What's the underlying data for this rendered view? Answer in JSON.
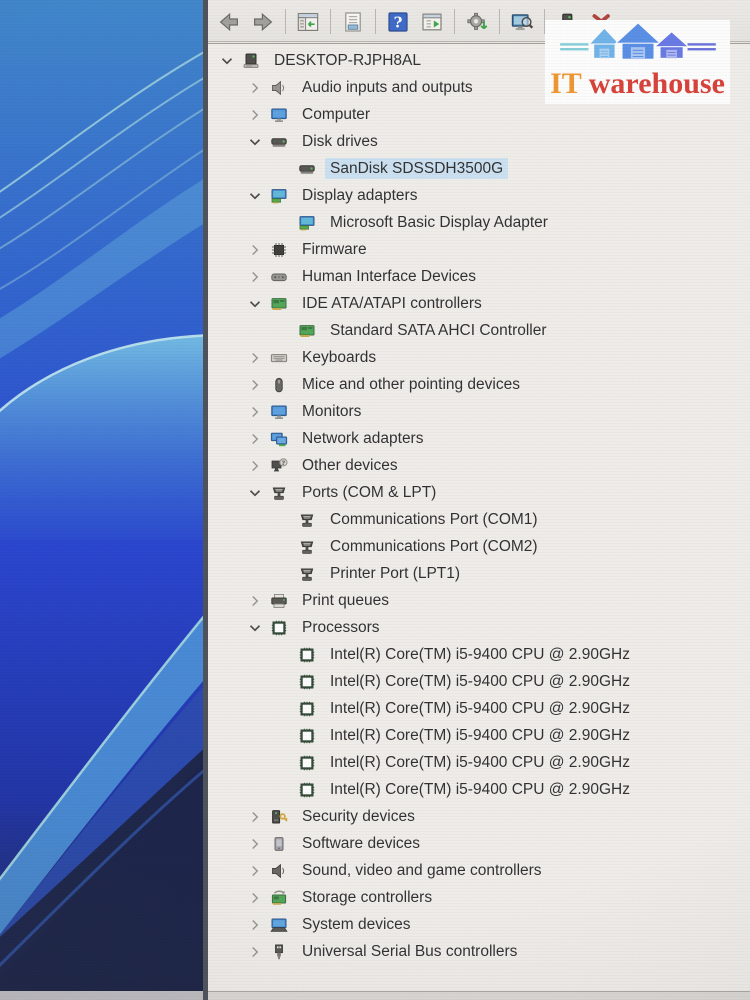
{
  "logo": {
    "it": "IT",
    "warehouse": "warehouse",
    "icon": "three-houses-logo"
  },
  "toolbar": {
    "buttons": [
      {
        "icon": "back-arrow",
        "name": "back-button"
      },
      {
        "icon": "forward-arrow",
        "name": "forward-button"
      },
      {
        "sep": true
      },
      {
        "icon": "console-tree",
        "name": "show-hide-console-tree-button"
      },
      {
        "sep": true
      },
      {
        "icon": "properties",
        "name": "properties-button"
      },
      {
        "sep": true
      },
      {
        "icon": "help",
        "name": "help-button"
      },
      {
        "icon": "update-driver",
        "name": "update-driver-button"
      },
      {
        "sep": true
      },
      {
        "icon": "gear-update",
        "name": "driver-settings-button"
      },
      {
        "sep": true
      },
      {
        "icon": "scan-computer",
        "name": "scan-hardware-changes-button"
      },
      {
        "sep": true
      },
      {
        "icon": "device-dark",
        "name": "device-action-button"
      },
      {
        "icon": "uninstall-x",
        "name": "uninstall-device-button"
      }
    ],
    "colors": {
      "uninstall_red": "#a9362c",
      "action_green": "#2f9e38",
      "help_blue": "#2d5ec6"
    }
  },
  "tree": {
    "selection_color": "#c9e0f2",
    "items": [
      {
        "label": "DESKTOP-RJPH8AL",
        "level": 0,
        "state": "expanded",
        "icon": "computer-root",
        "selected": false
      },
      {
        "label": "Audio inputs and outputs",
        "level": 1,
        "state": "collapsed",
        "icon": "speaker",
        "selected": false
      },
      {
        "label": "Computer",
        "level": 1,
        "state": "collapsed",
        "icon": "monitor",
        "selected": false
      },
      {
        "label": "Disk drives",
        "level": 1,
        "state": "expanded",
        "icon": "disk",
        "selected": false
      },
      {
        "label": "SanDisk SDSSDH3500G",
        "level": 2,
        "state": "leaf",
        "icon": "disk",
        "selected": true
      },
      {
        "label": "Display adapters",
        "level": 1,
        "state": "expanded",
        "icon": "display-adapter",
        "selected": false
      },
      {
        "label": "Microsoft Basic Display Adapter",
        "level": 2,
        "state": "leaf",
        "icon": "display-adapter",
        "selected": false
      },
      {
        "label": "Firmware",
        "level": 1,
        "state": "collapsed",
        "icon": "chip",
        "selected": false
      },
      {
        "label": "Human Interface Devices",
        "level": 1,
        "state": "collapsed",
        "icon": "hid",
        "selected": false
      },
      {
        "label": "IDE ATA/ATAPI controllers",
        "level": 1,
        "state": "expanded",
        "icon": "ide-card",
        "selected": false
      },
      {
        "label": "Standard SATA AHCI Controller",
        "level": 2,
        "state": "leaf",
        "icon": "ide-card",
        "selected": false
      },
      {
        "label": "Keyboards",
        "level": 1,
        "state": "collapsed",
        "icon": "keyboard",
        "selected": false
      },
      {
        "label": "Mice and other pointing devices",
        "level": 1,
        "state": "collapsed",
        "icon": "mouse",
        "selected": false
      },
      {
        "label": "Monitors",
        "level": 1,
        "state": "collapsed",
        "icon": "monitor",
        "selected": false
      },
      {
        "label": "Network adapters",
        "level": 1,
        "state": "collapsed",
        "icon": "network",
        "selected": false
      },
      {
        "label": "Other devices",
        "level": 1,
        "state": "collapsed",
        "icon": "unknown-device",
        "selected": false
      },
      {
        "label": "Ports (COM & LPT)",
        "level": 1,
        "state": "expanded",
        "icon": "port",
        "selected": false
      },
      {
        "label": "Communications Port (COM1)",
        "level": 2,
        "state": "leaf",
        "icon": "port",
        "selected": false
      },
      {
        "label": "Communications Port (COM2)",
        "level": 2,
        "state": "leaf",
        "icon": "port",
        "selected": false
      },
      {
        "label": "Printer Port (LPT1)",
        "level": 2,
        "state": "leaf",
        "icon": "port",
        "selected": false
      },
      {
        "label": "Print queues",
        "level": 1,
        "state": "collapsed",
        "icon": "printer",
        "selected": false
      },
      {
        "label": "Processors",
        "level": 1,
        "state": "expanded",
        "icon": "cpu",
        "selected": false
      },
      {
        "label": "Intel(R) Core(TM) i5-9400 CPU @ 2.90GHz",
        "level": 2,
        "state": "leaf",
        "icon": "cpu",
        "selected": false
      },
      {
        "label": "Intel(R) Core(TM) i5-9400 CPU @ 2.90GHz",
        "level": 2,
        "state": "leaf",
        "icon": "cpu",
        "selected": false
      },
      {
        "label": "Intel(R) Core(TM) i5-9400 CPU @ 2.90GHz",
        "level": 2,
        "state": "leaf",
        "icon": "cpu",
        "selected": false
      },
      {
        "label": "Intel(R) Core(TM) i5-9400 CPU @ 2.90GHz",
        "level": 2,
        "state": "leaf",
        "icon": "cpu",
        "selected": false
      },
      {
        "label": "Intel(R) Core(TM) i5-9400 CPU @ 2.90GHz",
        "level": 2,
        "state": "leaf",
        "icon": "cpu",
        "selected": false
      },
      {
        "label": "Intel(R) Core(TM) i5-9400 CPU @ 2.90GHz",
        "level": 2,
        "state": "leaf",
        "icon": "cpu",
        "selected": false
      },
      {
        "label": "Security devices",
        "level": 1,
        "state": "collapsed",
        "icon": "security",
        "selected": false
      },
      {
        "label": "Software devices",
        "level": 1,
        "state": "collapsed",
        "icon": "software",
        "selected": false
      },
      {
        "label": "Sound, video and game controllers",
        "level": 1,
        "state": "collapsed",
        "icon": "speaker-dark",
        "selected": false
      },
      {
        "label": "Storage controllers",
        "level": 1,
        "state": "collapsed",
        "icon": "storage",
        "selected": false
      },
      {
        "label": "System devices",
        "level": 1,
        "state": "collapsed",
        "icon": "system",
        "selected": false
      },
      {
        "label": "Universal Serial Bus controllers",
        "level": 1,
        "state": "collapsed",
        "icon": "usb",
        "selected": false
      }
    ]
  }
}
